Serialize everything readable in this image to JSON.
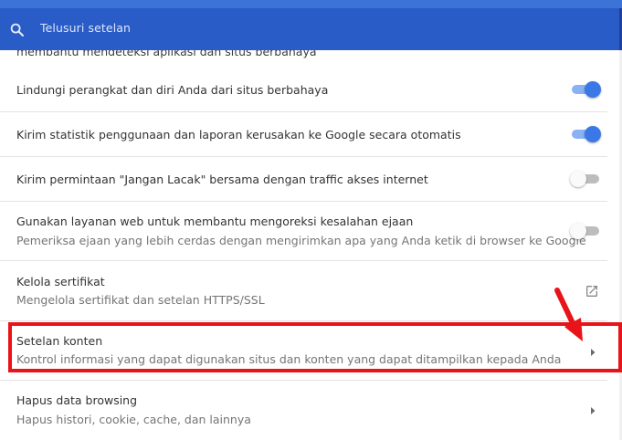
{
  "search": {
    "placeholder": "Telusuri setelan",
    "icon": "search-icon"
  },
  "colors": {
    "header": "#2a5cc7",
    "toggle_on": "#3b78e7",
    "highlight": "#e8141a"
  },
  "partial_row": {
    "text": "membantu mendeteksi aplikasi dan situs berbahaya"
  },
  "rows": [
    {
      "title": "Lindungi perangkat dan diri Anda dari situs berbahaya",
      "control": "toggle",
      "checked": true
    },
    {
      "title": "Kirim statistik penggunaan dan laporan kerusakan ke Google secara otomatis",
      "control": "toggle",
      "checked": true
    },
    {
      "title": "Kirim permintaan \"Jangan Lacak\" bersama dengan traffic akses internet",
      "control": "toggle",
      "checked": false
    },
    {
      "title": "Gunakan layanan web untuk membantu mengoreksi kesalahan ejaan",
      "subtitle": "Pemeriksa ejaan yang lebih cerdas dengan mengirimkan apa yang Anda ketik di browser ke Google",
      "control": "toggle",
      "checked": false
    },
    {
      "title": "Kelola sertifikat",
      "subtitle": "Mengelola sertifikat dan setelan HTTPS/SSL",
      "control": "launch-icon"
    },
    {
      "title": "Setelan konten",
      "subtitle": "Kontrol informasi yang dapat digunakan situs dan konten yang dapat ditampilkan kepada Anda",
      "control": "arrow-right-icon",
      "highlighted": true
    },
    {
      "title": "Hapus data browsing",
      "subtitle": "Hapus histori, cookie, cache, dan lainnya",
      "control": "arrow-right-icon"
    }
  ]
}
